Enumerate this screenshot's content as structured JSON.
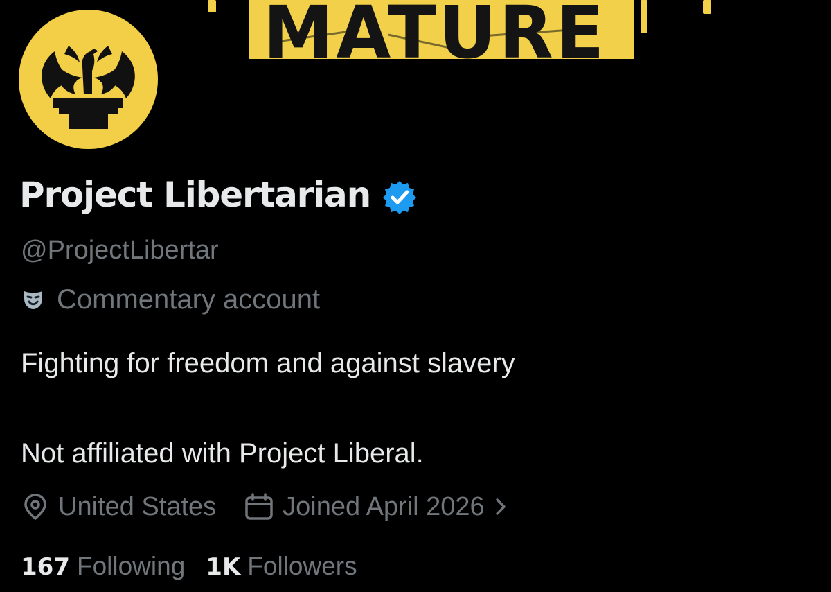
{
  "banner": {
    "sign_text": "MATURE",
    "sign_color": "#f2d04a",
    "background_color": "#000000"
  },
  "avatar": {
    "icon": "phoenix-logo-icon",
    "background_color": "#f3cf48"
  },
  "profile": {
    "display_name": "Project Libertarian",
    "verified_badge": "verified-badge-icon",
    "handle": "@ProjectLibertar",
    "label_icon": "theater-masks-icon",
    "label_text": "Commentary account",
    "bio_line_1": "Fighting for freedom and against slavery",
    "bio_line_2": "Not affiliated with Project Liberal.",
    "location_icon": "location-pin-icon",
    "location": "United States",
    "joined_icon": "calendar-icon",
    "joined": "Joined April 2026",
    "joined_chevron": "chevron-right-icon",
    "following_count": "167",
    "following_label": "Following",
    "followers_count": "1K",
    "followers_label": "Followers"
  },
  "colors": {
    "primary_text": "#e7e9ea",
    "secondary_text": "#71767b",
    "verified_blue": "#1d9bf0"
  }
}
